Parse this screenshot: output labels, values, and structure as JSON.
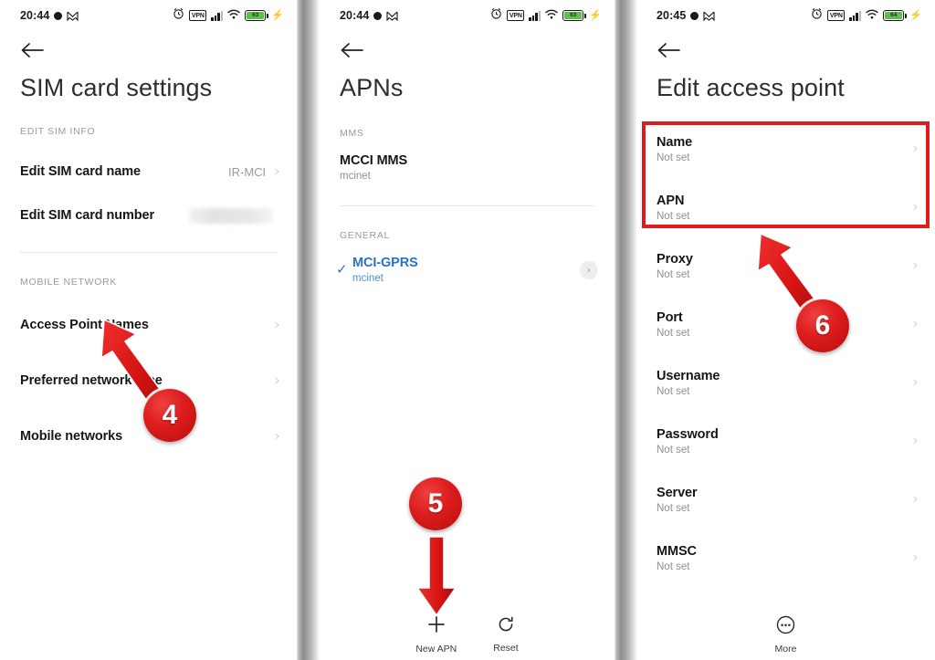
{
  "panels": [
    {
      "id": "sim-card-settings",
      "status_bar": {
        "clock": "20:44",
        "vpn_label": "VPN",
        "battery_pct": "63",
        "icons": [
          "alarm-icon",
          "vpn-icon",
          "signal-icon",
          "wifi-icon",
          "battery-icon",
          "charging-bolt-icon"
        ]
      },
      "title": "SIM card settings",
      "sections": [
        {
          "label": "EDIT SIM INFO",
          "rows": [
            {
              "title": "Edit SIM card name",
              "value": "IR-MCI",
              "redacted": false
            },
            {
              "title": "Edit SIM card number",
              "value": "",
              "redacted": true
            }
          ]
        },
        {
          "label": "MOBILE NETWORK",
          "rows": [
            {
              "title": "Access Point Names",
              "value": "",
              "redacted": false
            },
            {
              "title": "Preferred network type",
              "value": "",
              "redacted": false
            },
            {
              "title": "Mobile networks",
              "value": "",
              "redacted": false
            }
          ]
        }
      ]
    },
    {
      "id": "apns",
      "status_bar": {
        "clock": "20:44",
        "vpn_label": "VPN",
        "battery_pct": "63",
        "icons": [
          "alarm-icon",
          "vpn-icon",
          "signal-icon",
          "wifi-icon",
          "battery-icon",
          "charging-bolt-icon"
        ]
      },
      "title": "APNs",
      "sections": [
        {
          "label": "MMS",
          "rows": [
            {
              "title": "MCCI MMS",
              "sub": "mcinet",
              "selected": false
            }
          ]
        },
        {
          "label": "GENERAL",
          "rows": [
            {
              "title": "MCI-GPRS",
              "sub": "mcinet",
              "selected": true
            }
          ]
        }
      ],
      "bottom_bar": [
        {
          "label": "New APN",
          "icon": "plus-icon"
        },
        {
          "label": "Reset",
          "icon": "reset-icon"
        }
      ]
    },
    {
      "id": "edit-access-point",
      "status_bar": {
        "clock": "20:45",
        "vpn_label": "VPN",
        "battery_pct": "64",
        "icons": [
          "alarm-icon",
          "vpn-icon",
          "signal-icon",
          "wifi-icon",
          "battery-icon",
          "charging-bolt-icon"
        ]
      },
      "title": "Edit access point",
      "rows": [
        {
          "title": "Name",
          "sub": "Not set"
        },
        {
          "title": "APN",
          "sub": "Not set"
        },
        {
          "title": "Proxy",
          "sub": "Not set"
        },
        {
          "title": "Port",
          "sub": "Not set"
        },
        {
          "title": "Username",
          "sub": "Not set"
        },
        {
          "title": "Password",
          "sub": "Not set"
        },
        {
          "title": "Server",
          "sub": "Not set"
        },
        {
          "title": "MMSC",
          "sub": "Not set"
        }
      ],
      "bottom_bar": [
        {
          "label": "More",
          "icon": "more-icon"
        }
      ]
    }
  ],
  "annotations": {
    "step4": {
      "number": "4"
    },
    "step5": {
      "number": "5"
    },
    "step6": {
      "number": "6"
    }
  },
  "colors": {
    "accent_red": "#e01b1b",
    "link_blue": "#2a72c8",
    "battery_green": "#5cc14a",
    "muted_text": "#8f8f8f"
  }
}
